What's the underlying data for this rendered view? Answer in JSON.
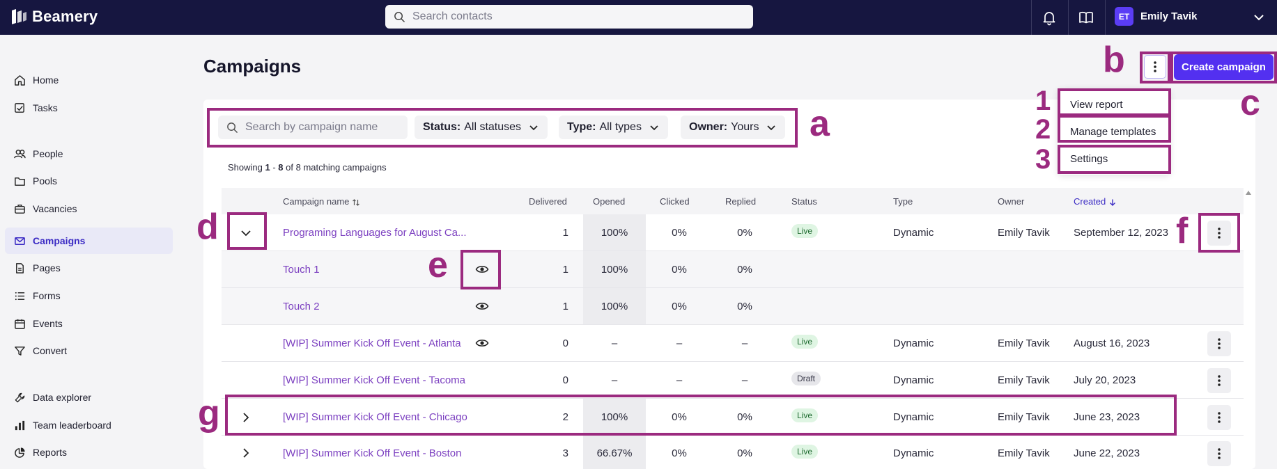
{
  "app": {
    "name": "Beamery"
  },
  "topbar": {
    "search_placeholder": "Search contacts",
    "user": {
      "initials": "ET",
      "name": "Emily Tavik"
    }
  },
  "sidebar": {
    "items": [
      {
        "label": "Home",
        "icon": "home-icon"
      },
      {
        "label": "Tasks",
        "icon": "tasks-icon"
      },
      {
        "label": "People",
        "icon": "people-icon"
      },
      {
        "label": "Pools",
        "icon": "folder-icon"
      },
      {
        "label": "Vacancies",
        "icon": "briefcase-icon"
      },
      {
        "label": "Campaigns",
        "icon": "mail-icon",
        "active": true
      },
      {
        "label": "Pages",
        "icon": "page-icon"
      },
      {
        "label": "Forms",
        "icon": "list-icon"
      },
      {
        "label": "Events",
        "icon": "calendar-icon"
      },
      {
        "label": "Convert",
        "icon": "filter-icon"
      },
      {
        "label": "Data explorer",
        "icon": "wrench-icon"
      },
      {
        "label": "Team leaderboard",
        "icon": "bar-chart-icon"
      },
      {
        "label": "Reports",
        "icon": "pie-icon"
      }
    ]
  },
  "main": {
    "title": "Campaigns",
    "create_button": "Create campaign",
    "search_placeholder": "Search by campaign name",
    "filters": [
      {
        "key": "Status:",
        "value": "All statuses"
      },
      {
        "key": "Type:",
        "value": "All types"
      },
      {
        "key": "Owner:",
        "value": "Yours"
      }
    ],
    "showing": {
      "prefix": "Showing",
      "range_start": "1",
      "range_dash": " - ",
      "range_end": "8",
      "suffix": " of 8 matching campaigns"
    },
    "menu": [
      "View report",
      "Manage templates",
      "Settings"
    ]
  },
  "table": {
    "columns": [
      "Campaign name",
      "Delivered",
      "Opened",
      "Clicked",
      "Replied",
      "Status",
      "Type",
      "Owner",
      "Created"
    ],
    "rows": [
      {
        "name": "Programing Languages for August Ca...",
        "delivered": "1",
        "opened": "100%",
        "clicked": "0%",
        "replied": "0%",
        "status": "Live",
        "type": "Dynamic",
        "owner": "Emily Tavik",
        "created": "September 12, 2023"
      },
      {
        "name": "Touch 1",
        "delivered": "1",
        "opened": "100%",
        "clicked": "0%",
        "replied": "0%"
      },
      {
        "name": "Touch 2",
        "delivered": "1",
        "opened": "100%",
        "clicked": "0%",
        "replied": "0%"
      },
      {
        "name": "[WIP] Summer Kick Off Event - Atlanta",
        "delivered": "0",
        "opened": "–",
        "clicked": "–",
        "replied": "–",
        "status": "Live",
        "type": "Dynamic",
        "owner": "Emily Tavik",
        "created": "August 16, 2023"
      },
      {
        "name": "[WIP] Summer Kick Off Event - Tacoma",
        "delivered": "0",
        "opened": "–",
        "clicked": "–",
        "replied": "–",
        "status": "Draft",
        "type": "Dynamic",
        "owner": "Emily Tavik",
        "created": "July 20, 2023"
      },
      {
        "name": "[WIP] Summer Kick Off Event - Chicago",
        "delivered": "2",
        "opened": "100%",
        "clicked": "0%",
        "replied": "0%",
        "status": "Live",
        "type": "Dynamic",
        "owner": "Emily Tavik",
        "created": "June 23, 2023"
      },
      {
        "name": "[WIP] Summer Kick Off Event - Boston",
        "delivered": "3",
        "opened": "66.67%",
        "clicked": "0%",
        "replied": "0%",
        "status": "Live",
        "type": "Dynamic",
        "owner": "Emily Tavik",
        "created": "June 22, 2023"
      }
    ]
  },
  "annotations": {
    "letters": [
      "a",
      "b",
      "c",
      "d",
      "e",
      "f",
      "g"
    ],
    "numbers": [
      "1",
      "2",
      "3"
    ],
    "color": "#9b2a7f"
  },
  "colors": {
    "topbar": "#161640",
    "accent": "#5330f0",
    "link": "#7b3fc0"
  }
}
